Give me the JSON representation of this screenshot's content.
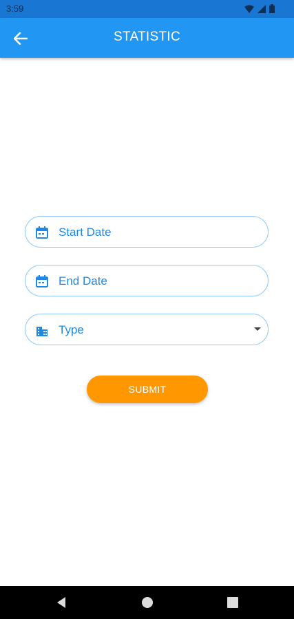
{
  "status_bar": {
    "time": "3:59",
    "icons": [
      "wifi-icon",
      "signal-icon",
      "battery-icon"
    ]
  },
  "app_bar": {
    "title": "STATISTIC",
    "back_icon": "arrow-left-icon"
  },
  "form": {
    "start_date": {
      "label": "Start Date",
      "icon": "calendar-icon"
    },
    "end_date": {
      "label": "End Date",
      "icon": "calendar-icon"
    },
    "type": {
      "label": "Type",
      "icon": "business-icon",
      "trailing_icon": "dropdown-arrow-icon"
    },
    "submit_label": "SUBMIT"
  },
  "nav_bar": {
    "buttons": [
      "back-triangle-icon",
      "home-circle-icon",
      "recents-square-icon"
    ]
  },
  "colors": {
    "status_bar": "#1976d2",
    "app_bar": "#2196f3",
    "accent": "#1e88e5",
    "field_border": "#90caf9",
    "submit": "#ff9800",
    "nav_bar": "#000000"
  }
}
